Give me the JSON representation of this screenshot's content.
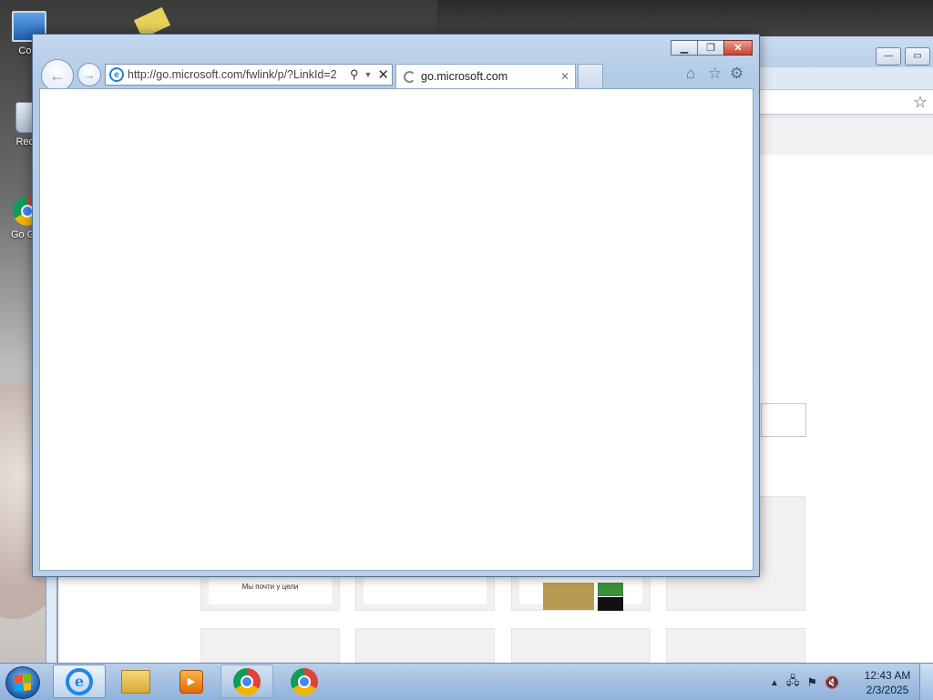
{
  "desktop": {
    "icons": [
      {
        "label": "Com"
      },
      {
        "label": "Recy"
      },
      {
        "label": "Go Ghr"
      }
    ]
  },
  "background_window": {
    "tile_text": "Мы почти у цели"
  },
  "ie_window": {
    "address": "http://go.microsoft.com/fwlink/p/?LinkId=2",
    "tab_title": "go.microsoft.com",
    "controls": {
      "minimize": "minimize",
      "restore": "restore",
      "close": "close"
    }
  },
  "taskbar": {
    "pinned": [
      "internet-explorer",
      "file-explorer",
      "media-player",
      "chrome"
    ],
    "running": [
      "chrome"
    ],
    "clock_time": "12:43 AM",
    "clock_date": "2/3/2025"
  }
}
